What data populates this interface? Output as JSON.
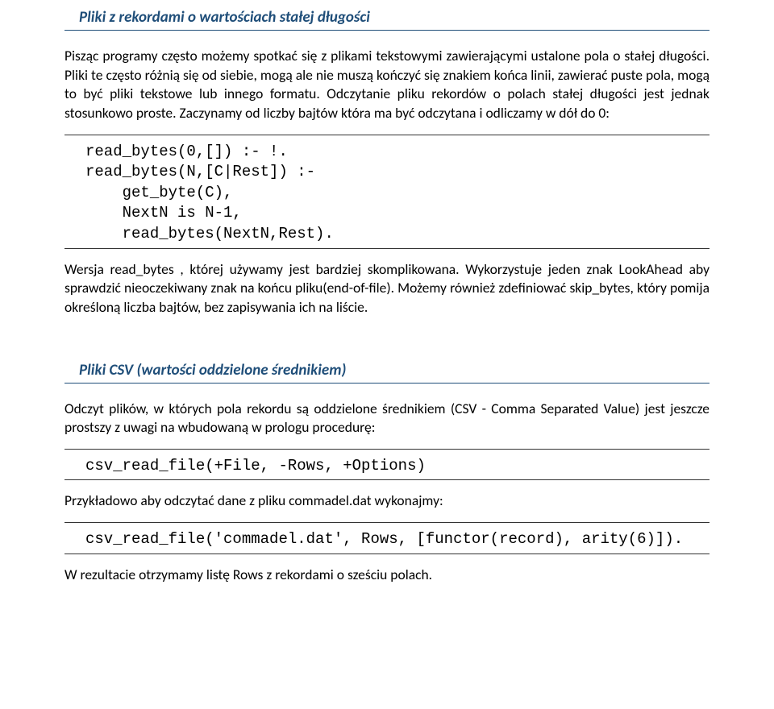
{
  "section1": {
    "title": "Pliki z rekordami o wartościach stałej długości",
    "para1": "Pisząc programy często możemy spotkać się z plikami tekstowymi zawierającymi ustalone pola o stałej długości. Pliki te często różnią się od siebie, mogą ale nie muszą kończyć się znakiem końca linii, zawierać puste pola, mogą to być pliki tekstowe lub innego formatu. Odczytanie pliku rekordów o polach stałej długości jest jednak stosunkowo proste. Zaczynamy od liczby bajtów która ma być odczytana i odliczamy w dół do 0:",
    "code1": "read_bytes(0,[]) :- !.\nread_bytes(N,[C|Rest]) :-\n    get_byte(C),\n    NextN is N-1,\n    read_bytes(NextN,Rest).",
    "para2": "Wersja read_bytes , której używamy jest bardziej skomplikowana. Wykorzystuje jeden znak LookAhead aby sprawdzić nieoczekiwany znak na końcu pliku(end-of-file). Możemy również zdefiniować skip_bytes, który pomija określoną liczba bajtów, bez zapisywania ich na liście."
  },
  "section2": {
    "title": "Pliki CSV (wartości oddzielone średnikiem)",
    "para1": "Odczyt plików, w których pola rekordu są oddzielone średnikiem (CSV - Comma Separated Value) jest jeszcze prostszy z uwagi na wbudowaną w prologu procedurę:",
    "code1": "csv_read_file(+File, -Rows, +Options)",
    "para2": "Przykładowo aby odczytać dane z pliku commadel.dat wykonajmy:",
    "code2": "csv_read_file('commadel.dat', Rows, [functor(record), arity(6)]).",
    "para3": "W rezultacie otrzymamy listę Rows z rekordami o sześciu polach."
  }
}
